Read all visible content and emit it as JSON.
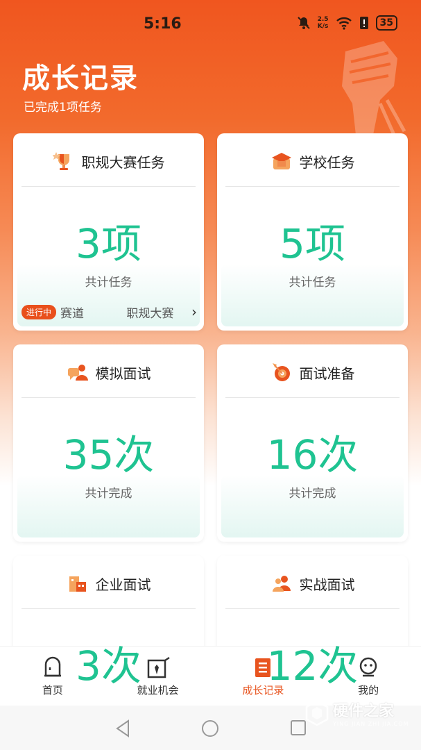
{
  "status": {
    "time": "5:16",
    "speed_top": "2.5",
    "speed_bottom": "K/s",
    "battery": "35"
  },
  "header": {
    "title": "成长记录",
    "subtitle": "已完成1项任务"
  },
  "cards": [
    {
      "title": "职规大赛任务",
      "value": "3项",
      "caption": "共计任务",
      "icon": "trophy-icon",
      "status_pill": "进行中",
      "ticker": [
        "赛道",
        "职规大赛"
      ]
    },
    {
      "title": "学校任务",
      "value": "5项",
      "caption": "共计任务",
      "icon": "graduation-cap-icon"
    },
    {
      "title": "模拟面试",
      "value": "35次",
      "caption": "共计完成",
      "icon": "interview-chat-icon"
    },
    {
      "title": "面试准备",
      "value": "16次",
      "caption": "共计完成",
      "icon": "target-icon"
    },
    {
      "title": "企业面试",
      "value": "3次",
      "caption": "",
      "icon": "building-icon"
    },
    {
      "title": "实战面试",
      "value": "12次",
      "caption": "",
      "icon": "people-icon"
    }
  ],
  "tabs": [
    {
      "label": "首页",
      "icon": "home-icon",
      "active": false
    },
    {
      "label": "就业机会",
      "icon": "job-icon",
      "active": false
    },
    {
      "label": "成长记录",
      "icon": "record-icon",
      "active": true
    },
    {
      "label": "我的",
      "icon": "profile-icon",
      "active": false
    }
  ],
  "watermark": {
    "main": "硬件之家",
    "sub": "YING JIAN ZHI JIA.COM"
  },
  "colors": {
    "accent": "#e8541f",
    "value_green": "#1fc391",
    "hero_top": "#f0561f"
  }
}
